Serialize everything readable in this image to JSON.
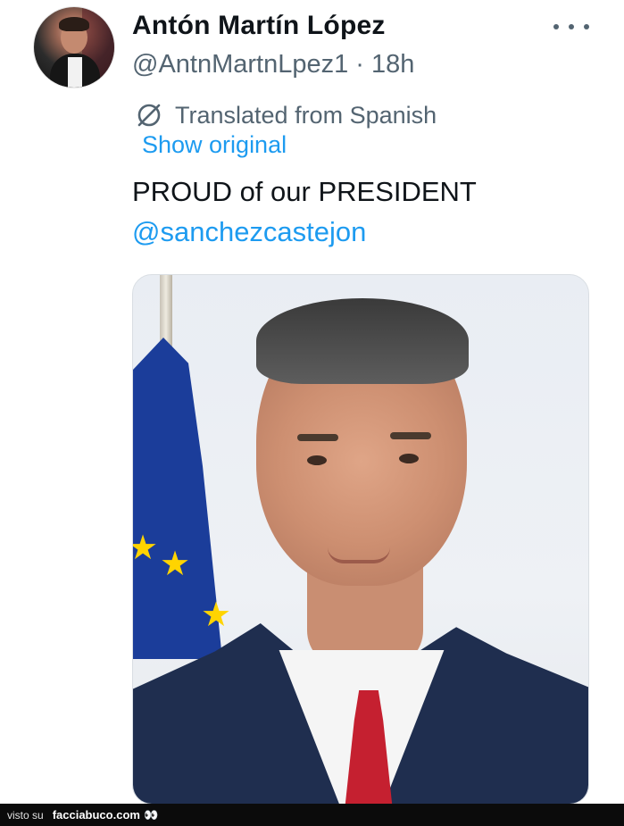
{
  "author": {
    "display_name": "Antón Martín López",
    "handle": "@AntnMartnLpez1",
    "separator": " · ",
    "time": "18h"
  },
  "translation": {
    "label": "Translated from Spanish",
    "show_original": "Show original",
    "icon": "translate-globe-icon"
  },
  "tweet": {
    "text": "PROUD of our PRESIDENT",
    "mention": "@sanchezcastejon"
  },
  "footer": {
    "prefix": "visto su",
    "site": "facciabuco.com",
    "logo_glyph": "👀"
  },
  "colors": {
    "link": "#1d9bf0",
    "secondary_text": "#536471",
    "primary_text": "#0f1419"
  }
}
